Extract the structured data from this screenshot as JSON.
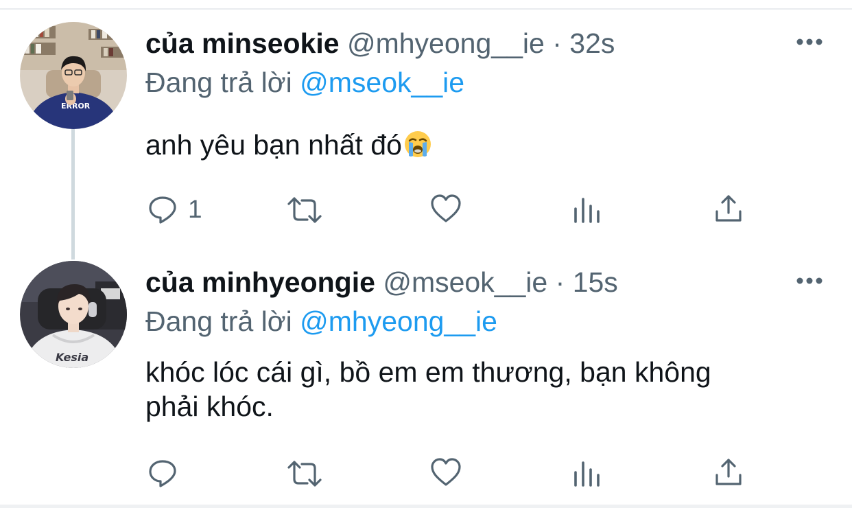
{
  "tweets": [
    {
      "display_name": "của minseokie",
      "handle": "@mhyeong__ie",
      "separator": "·",
      "time": "32s",
      "replying_prefix": "Đang trả lời",
      "replying_to": "@mseok__ie",
      "text": "anh yêu bạn nhất đó",
      "emoji": "loudly-crying-face",
      "reply_count": "1"
    },
    {
      "display_name": "của minhyeongie",
      "handle": "@mseok__ie",
      "separator": "·",
      "time": "15s",
      "replying_prefix": "Đang trả lời",
      "replying_to": "@mhyeong__ie",
      "text": "khóc lóc cái gì, bồ em em thương, bạn không phải khóc.",
      "reply_count": ""
    }
  ],
  "icons": [
    "reply-icon",
    "retweet-icon",
    "like-icon",
    "views-icon",
    "share-icon",
    "more-icon"
  ],
  "colors": {
    "link": "#1d9bf0",
    "secondary_text": "#536471",
    "primary_text": "#0f1419",
    "thread_line": "#cfd9de"
  }
}
